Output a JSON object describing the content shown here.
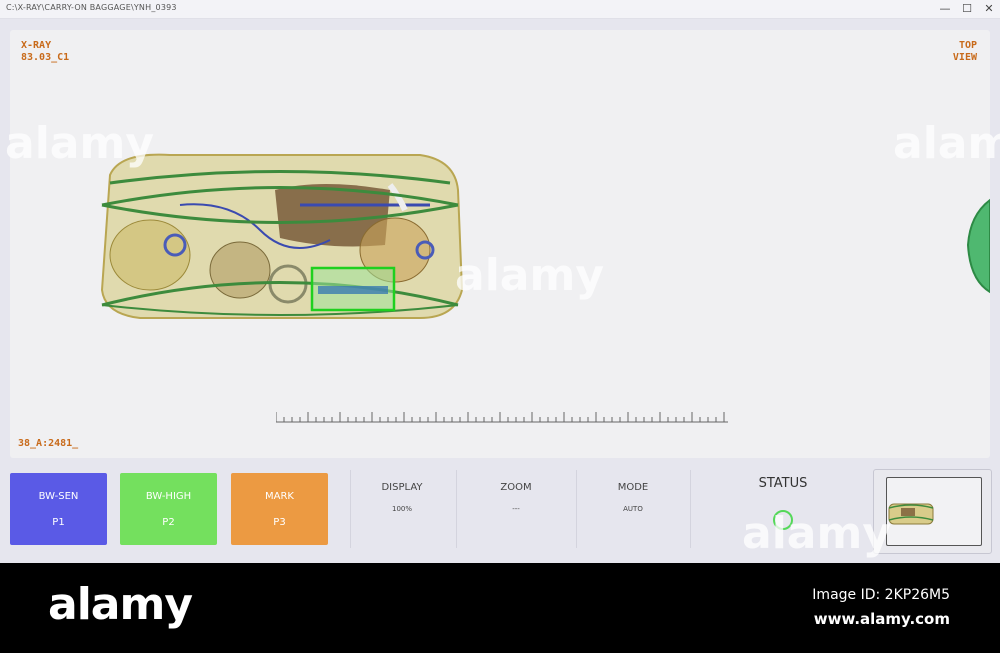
{
  "window": {
    "path": "C:\\X-RAY\\CARRY-ON BAGGAGE\\YNH_0393",
    "controls": [
      "—",
      "☐",
      "✕"
    ]
  },
  "viewer": {
    "top_left": [
      "X-RAY",
      "83.03_C1"
    ],
    "top_right": [
      "TOP",
      "VIEW"
    ],
    "bottom_left": "38_A:2481_"
  },
  "buttons": [
    {
      "label": "BW-SEN",
      "sub": "P1",
      "color": "#5a5ae6"
    },
    {
      "label": "BW-HIGH",
      "sub": "P2",
      "color": "#74e05e"
    },
    {
      "label": "MARK",
      "sub": "P3",
      "color": "#ec9a42"
    }
  ],
  "info": {
    "display": {
      "label": "DISPLAY",
      "value": "100%"
    },
    "zoom": {
      "label": "ZOOM",
      "value": "---"
    },
    "mode": {
      "label": "MODE",
      "value": "AUTO"
    }
  },
  "status": {
    "label": "STATUS",
    "indicator_color": "#55d85a"
  },
  "watermark": {
    "brand": "alamy",
    "image_id": "Image ID: 2KP26M5",
    "url": "www.alamy.com"
  }
}
